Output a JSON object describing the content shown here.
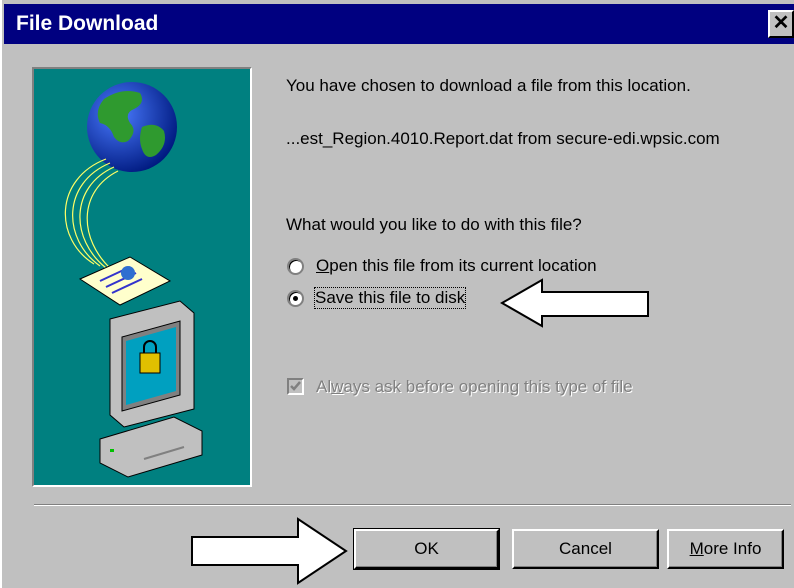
{
  "window": {
    "title": "File Download",
    "close_glyph": "✕"
  },
  "message": {
    "line1": "You have chosen to download a file from this location.",
    "line2": "...est_Region.4010.Report.dat from secure-edi.wpsic.com",
    "question": "What would you like to do with this file?"
  },
  "options": {
    "open_prefix": "",
    "open_mnemonic": "O",
    "open_rest": "pen this file from its current location",
    "save_label": "Save this file to disk",
    "selected": "save"
  },
  "checkbox": {
    "label_pre": "Al",
    "label_mnemonic": "w",
    "label_post": "ays ask before opening this type of file",
    "checked": true,
    "enabled": false
  },
  "buttons": {
    "ok": "OK",
    "cancel": "Cancel",
    "more_info_mnemonic": "M",
    "more_info_rest": "ore Info"
  },
  "colors": {
    "title_bar": "#000080",
    "dialog_face": "#c0c0c0",
    "art_background": "#008080"
  }
}
